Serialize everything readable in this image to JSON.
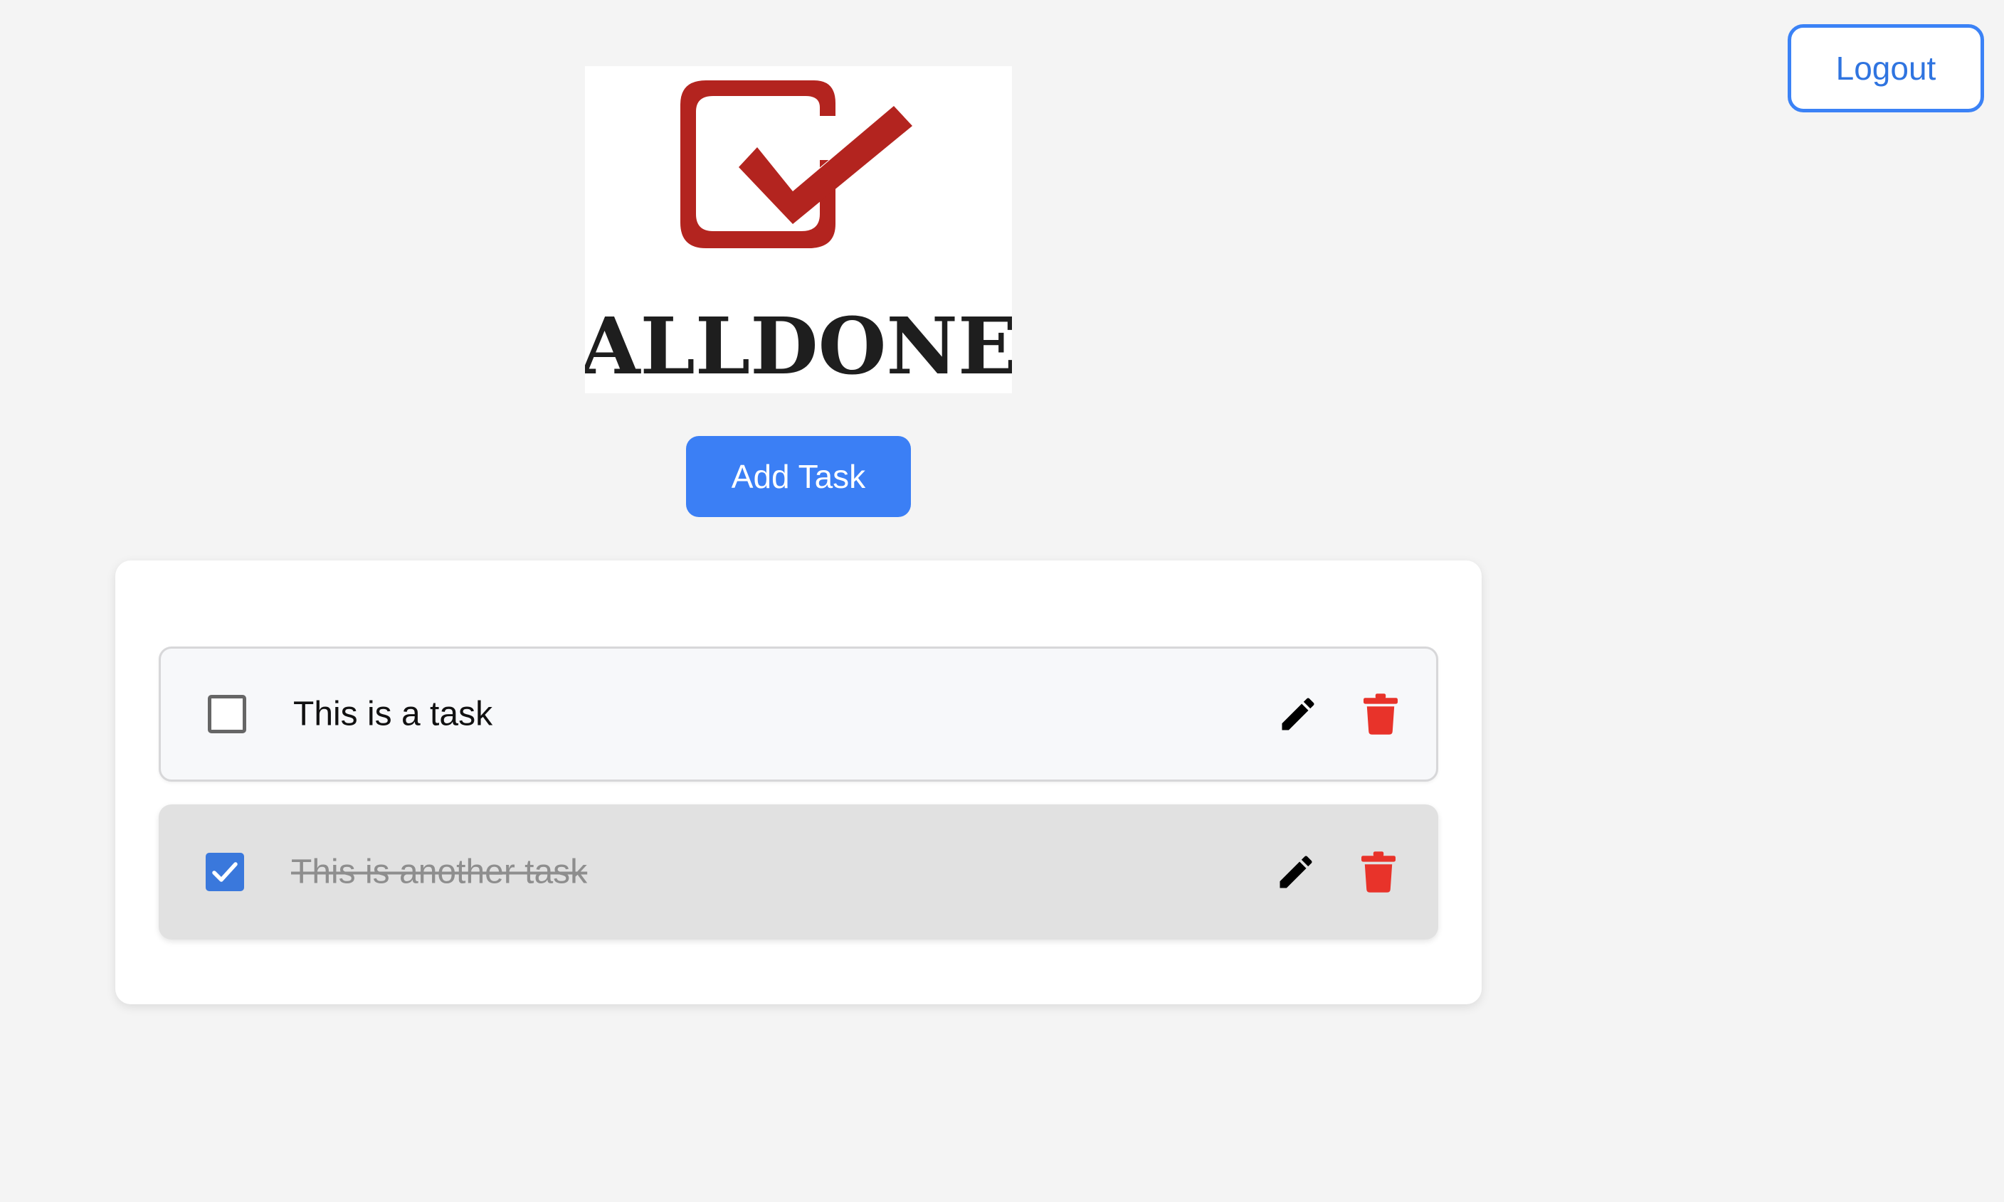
{
  "header": {
    "logout_label": "Logout"
  },
  "logo": {
    "brand_text": "ALLDONE",
    "accent_color": "#b3241f"
  },
  "toolbar": {
    "add_task_label": "Add Task"
  },
  "tasks": [
    {
      "text": "This is a task",
      "completed": false
    },
    {
      "text": "This is another task",
      "completed": true
    }
  ],
  "icons": {
    "edit": "pencil-icon",
    "delete": "trash-icon"
  },
  "colors": {
    "primary": "#3b7ff5",
    "delete": "#e8332a",
    "checked": "#3a78dc"
  }
}
